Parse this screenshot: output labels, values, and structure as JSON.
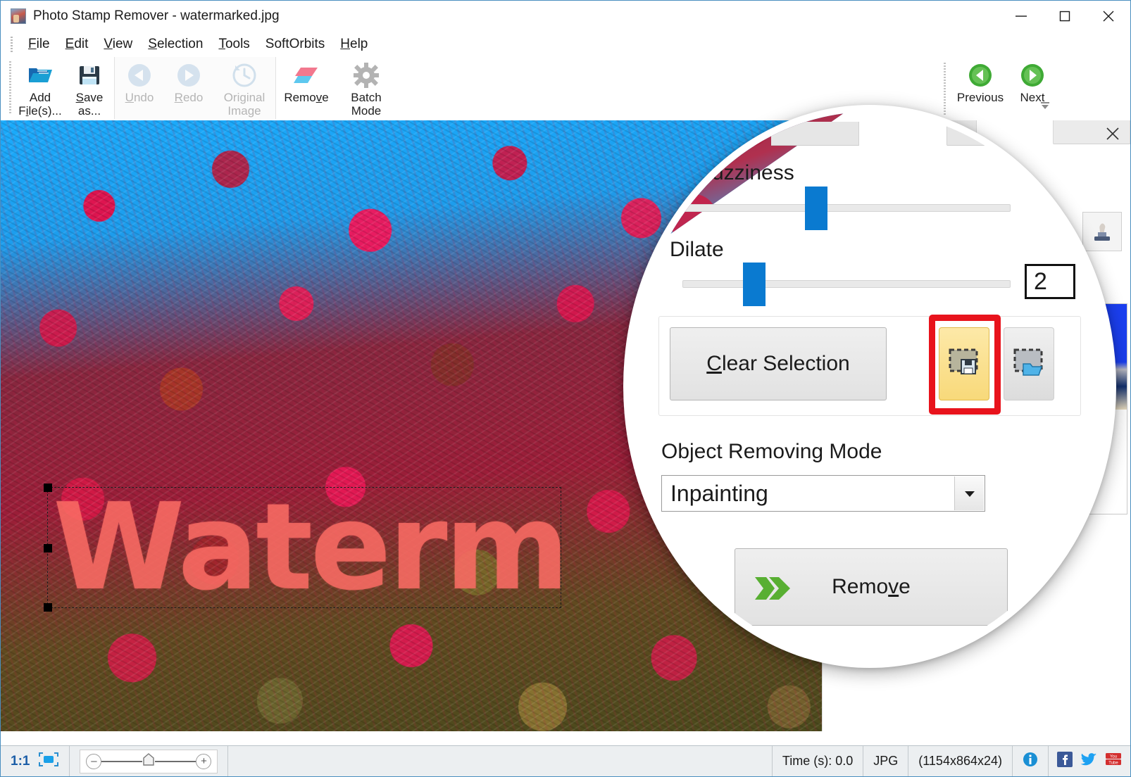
{
  "window": {
    "title": "Photo Stamp Remover - watermarked.jpg",
    "app_icon": "photo-app-icon",
    "minimize": "minimize-icon",
    "maximize": "maximize-icon",
    "close": "close-icon"
  },
  "menu": {
    "items": [
      {
        "label": "File",
        "mnemonic": "F"
      },
      {
        "label": "Edit",
        "mnemonic": "E"
      },
      {
        "label": "View",
        "mnemonic": "V"
      },
      {
        "label": "Selection",
        "mnemonic": "S"
      },
      {
        "label": "Tools",
        "mnemonic": "T"
      },
      {
        "label": "SoftOrbits",
        "mnemonic": ""
      },
      {
        "label": "Help",
        "mnemonic": "H"
      }
    ]
  },
  "toolbar": {
    "add_files": {
      "line1": "Add",
      "line2": "File(s)...",
      "icon": "open-folder-icon",
      "enabled": true
    },
    "save_as": {
      "line1": "Save",
      "line2": "as...",
      "icon": "floppy-disk-icon",
      "enabled": true
    },
    "undo": {
      "label": "Undo",
      "icon": "undo-arrow-icon",
      "enabled": false
    },
    "redo": {
      "label": "Redo",
      "icon": "redo-arrow-icon",
      "enabled": false
    },
    "original_image": {
      "line1": "Original",
      "line2": "Image",
      "icon": "clock-history-icon",
      "enabled": false
    },
    "remove": {
      "label": "Remove",
      "icon": "eraser-icon",
      "enabled": true
    },
    "batch_mode": {
      "line1": "Batch",
      "line2": "Mode",
      "icon": "gear-icon",
      "enabled": true
    },
    "previous": {
      "label": "Previous",
      "icon": "green-left-arrow-icon"
    },
    "next": {
      "label": "Next",
      "icon": "green-right-arrow-icon"
    },
    "expand": "ribbon-expand-icon"
  },
  "canvas": {
    "watermark_text": "Waterm",
    "selection_active": true,
    "watermark_color": "#fa6c64"
  },
  "panel": {
    "close_icon": "panel-close-icon",
    "stamp_tool_icon": "stamp-tool-icon",
    "color_fuzziness": {
      "label": "Color Fuzziness",
      "label_visible": "lor Fuzziness",
      "value_percent": 40
    },
    "dilate": {
      "label": "Dilate",
      "value": "2",
      "value_percent": 20
    },
    "clear_selection": {
      "label": "Clear Selection",
      "mnemonic": "C"
    },
    "save_selection": {
      "icon": "save-selection-icon",
      "state": "highlighted",
      "highlight_color": "#e8131c"
    },
    "load_selection": {
      "icon": "load-selection-icon",
      "state": "normal"
    },
    "object_removing_mode": {
      "label": "Object Removing Mode",
      "value": "Inpainting",
      "dropdown_icon": "chevron-down-icon"
    },
    "remove_button": {
      "label": "Remove",
      "mnemonic": "v",
      "icon": "green-double-chevron-icon"
    }
  },
  "statusbar": {
    "zoom_ratio": "1:1",
    "fit_icon": "fit-to-screen-icon",
    "zoom_out_icon": "minus-icon",
    "zoom_in_icon": "plus-icon",
    "zoom_handle_icon": "slider-handle-icon",
    "time": "Time (s): 0.0",
    "format": "JPG",
    "dimensions": "(1154x864x24)",
    "info_icon": "info-icon",
    "facebook_icon": "facebook-icon",
    "twitter_icon": "twitter-icon",
    "youtube_icon": "youtube-icon"
  },
  "colors": {
    "accent_blue": "#0a7ad0",
    "highlight_red": "#e8131c",
    "highlight_yellow": "#f8d97a",
    "green": "#3faa35",
    "link_blue": "#1d5fa8"
  }
}
